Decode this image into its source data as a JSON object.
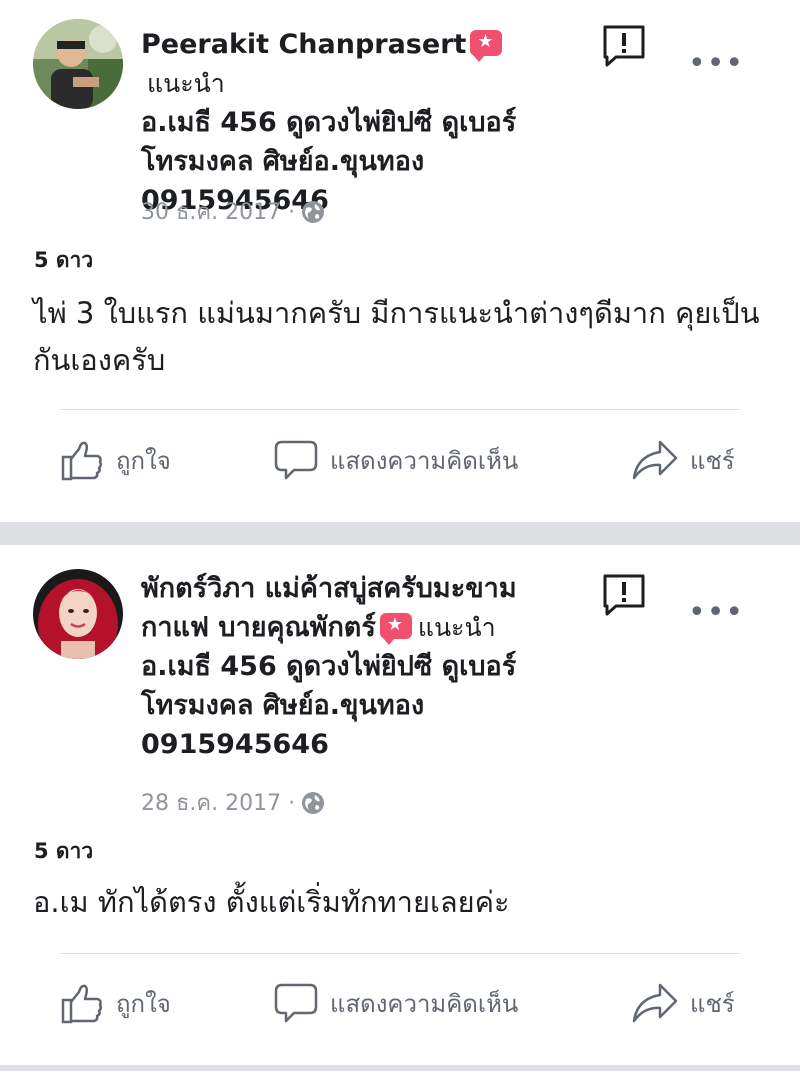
{
  "reviews": [
    {
      "author_line1": "Peerakit Chanprasert",
      "author_line2": "",
      "recommend_label": "แนะนำ",
      "target_lines": [
        "อ.เมธี 456 ดูดวงไพ่ยิปซี ดูเบอร์",
        "โทรมงคล ศิษย์อ.ขุนทอง",
        "0915945646"
      ],
      "date": "30 ธ.ค. 2017 ·",
      "rating": "5 ดาว",
      "text": "ไพ่ 3 ใบแรก แม่นมากครับ มีการแนะนำต่างๆดีมาก คุยเป็นกันเองครับ"
    },
    {
      "author_line1": "พักตร์วิภา แม่ค้าสบู่สครับมะขาม",
      "author_line2": "กาแฟ บายคุณพักตร์",
      "recommend_label": "แนะนำ",
      "target_lines": [
        "อ.เมธี 456 ดูดวงไพ่ยิปซี ดูเบอร์",
        "โทรมงคล ศิษย์อ.ขุนทอง",
        "0915945646"
      ],
      "date": "28 ธ.ค. 2017 ·",
      "rating": "5 ดาว",
      "text": "อ.เม ทักได้ตรง  ตั้งแต่เริ่มทักทายเลยค่ะ"
    }
  ],
  "actions": {
    "like": "ถูกใจ",
    "comment": "แสดงความคิดเห็น",
    "share": "แชร์"
  },
  "more_label": "•••",
  "colors": {
    "recommend_badge": "#f0506e",
    "separator": "#dddfe2",
    "meta_text": "#90949c",
    "action_text": "#606770"
  }
}
